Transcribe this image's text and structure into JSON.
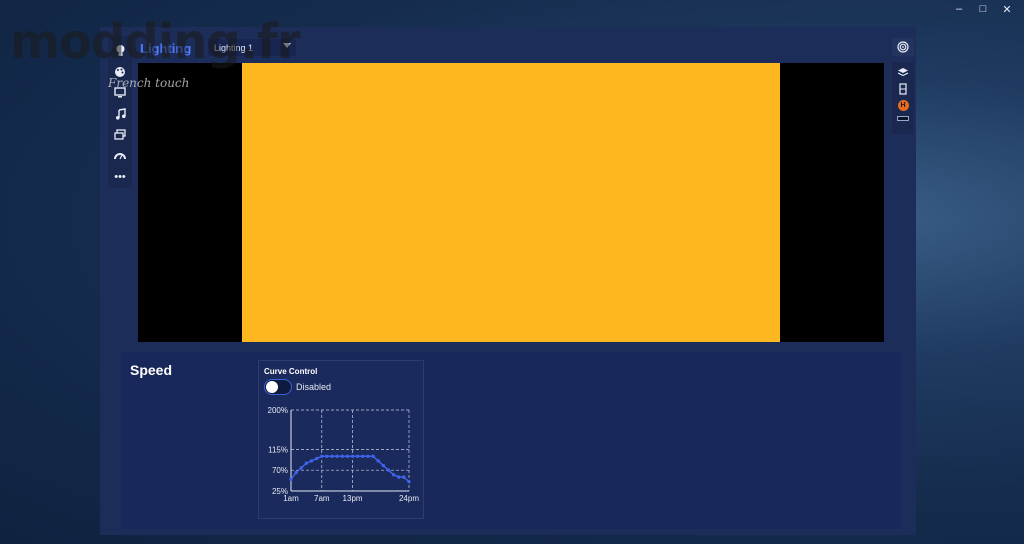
{
  "watermark": {
    "brand": "modding.fr",
    "tagline": "French touch"
  },
  "window_controls": [
    "–",
    "□",
    "✕"
  ],
  "header": {
    "title": "Lighting",
    "profile_select": {
      "value": "Lighting 1"
    }
  },
  "sidebar": {
    "items": [
      {
        "icon": "bulb-icon"
      },
      {
        "icon": "palette-icon"
      },
      {
        "icon": "monitor-icon"
      },
      {
        "icon": "music-icon"
      },
      {
        "icon": "gallery-icon"
      },
      {
        "icon": "gauge-icon"
      },
      {
        "icon": "more-icon",
        "glyph": "•••"
      }
    ]
  },
  "right_toolbar": {
    "items": [
      "spiral-icon",
      "layers-icon",
      "device-icon",
      "h-badge-icon",
      "slot-icon"
    ],
    "h_badge": "H"
  },
  "preview": {
    "color": "#ffb71f"
  },
  "speed_panel": {
    "title": "Speed",
    "curve_control": {
      "title": "Curve Control",
      "toggle_label": "Disabled",
      "toggle_on": false
    }
  },
  "chart_data": {
    "type": "line",
    "x_tick_labels": [
      "1am",
      "7am",
      "13pm",
      "24pm"
    ],
    "x_tick_positions": [
      1,
      7,
      13,
      24
    ],
    "y_tick_labels": [
      "200%",
      "115%",
      "70%",
      "25%"
    ],
    "y_tick_values": [
      200,
      115,
      70,
      25
    ],
    "ylim": [
      25,
      200
    ],
    "xlim": [
      1,
      24
    ],
    "grid": true,
    "series": [
      {
        "x": [
          1,
          2,
          3,
          4,
          5,
          6,
          7,
          8,
          9,
          10,
          11,
          12,
          13,
          14,
          15,
          16,
          17,
          18,
          19,
          20,
          21,
          22,
          23,
          24
        ],
        "values": [
          50,
          65,
          75,
          85,
          90,
          95,
          100,
          100,
          100,
          100,
          100,
          100,
          100,
          100,
          100,
          100,
          100,
          90,
          80,
          70,
          60,
          55,
          55,
          45
        ]
      }
    ],
    "line_color": "#3f63e8"
  }
}
